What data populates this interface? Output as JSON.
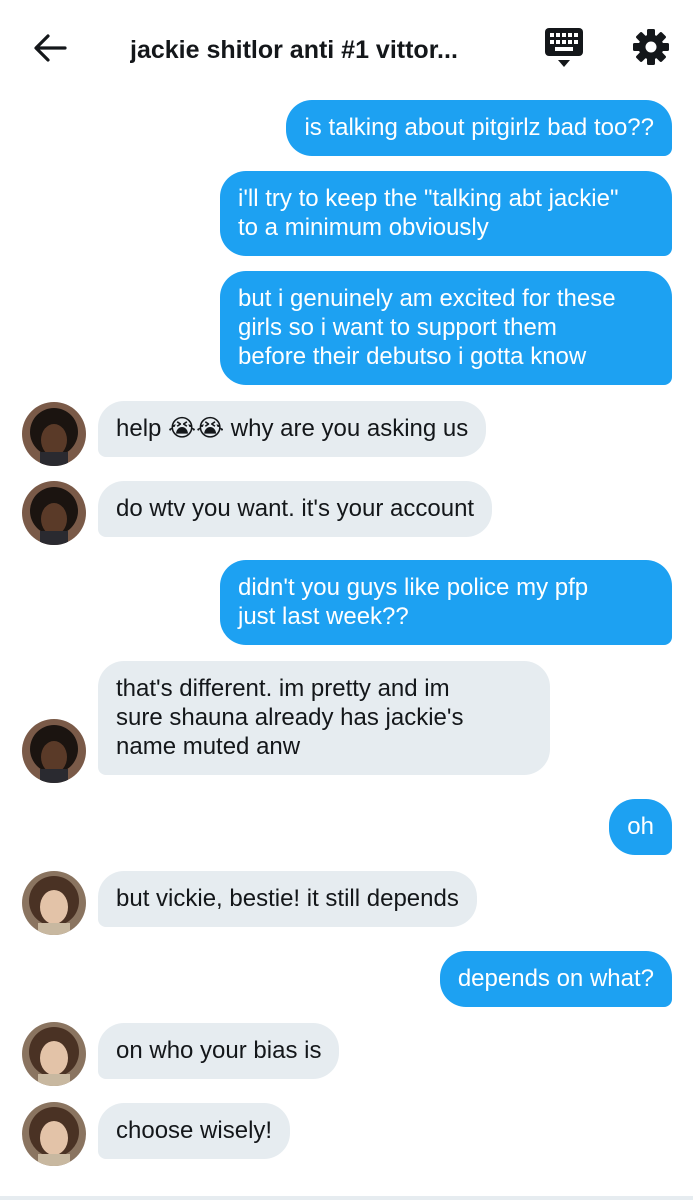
{
  "header": {
    "back_icon": "arrow-left-icon",
    "title": "jackie shitlor anti #1 vittor...",
    "keyboard_icon": "keyboard-icon",
    "settings_icon": "gear-icon"
  },
  "colors": {
    "accent": "#1da1f2",
    "incoming_bubble": "#e6ecf0",
    "text_dark": "#14171a"
  },
  "messages": [
    {
      "side": "out",
      "text": "is talking about pitgirlz bad too??"
    },
    {
      "side": "out",
      "text": "i'll try to keep the \"talking abt jackie\"\nto a minimum obviously"
    },
    {
      "side": "out",
      "text": "but i genuinely am excited for these\ngirls so i want to support them\nbefore their debutso i gotta know"
    },
    {
      "side": "in",
      "avatar": "avatar-dark-curly",
      "text": "help 😭😭 why are you asking us"
    },
    {
      "side": "in",
      "avatar": "avatar-dark-curly",
      "text": "do wtv you want. it's your account"
    },
    {
      "side": "out",
      "text": "didn't you guys like police my pfp\njust last week??"
    },
    {
      "side": "in",
      "avatar": "avatar-dark-curly",
      "text": "that's different.  im pretty and im\nsure shauna already has jackie's\nname muted anw"
    },
    {
      "side": "out",
      "text": "oh"
    },
    {
      "side": "in",
      "avatar": "avatar-light-curly",
      "text": "but vickie, bestie! it still depends"
    },
    {
      "side": "out",
      "text": "depends on what?"
    },
    {
      "side": "in",
      "avatar": "avatar-light-curly",
      "text": "on who your bias is"
    },
    {
      "side": "in",
      "avatar": "avatar-light-curly",
      "text": "choose wisely!"
    }
  ]
}
